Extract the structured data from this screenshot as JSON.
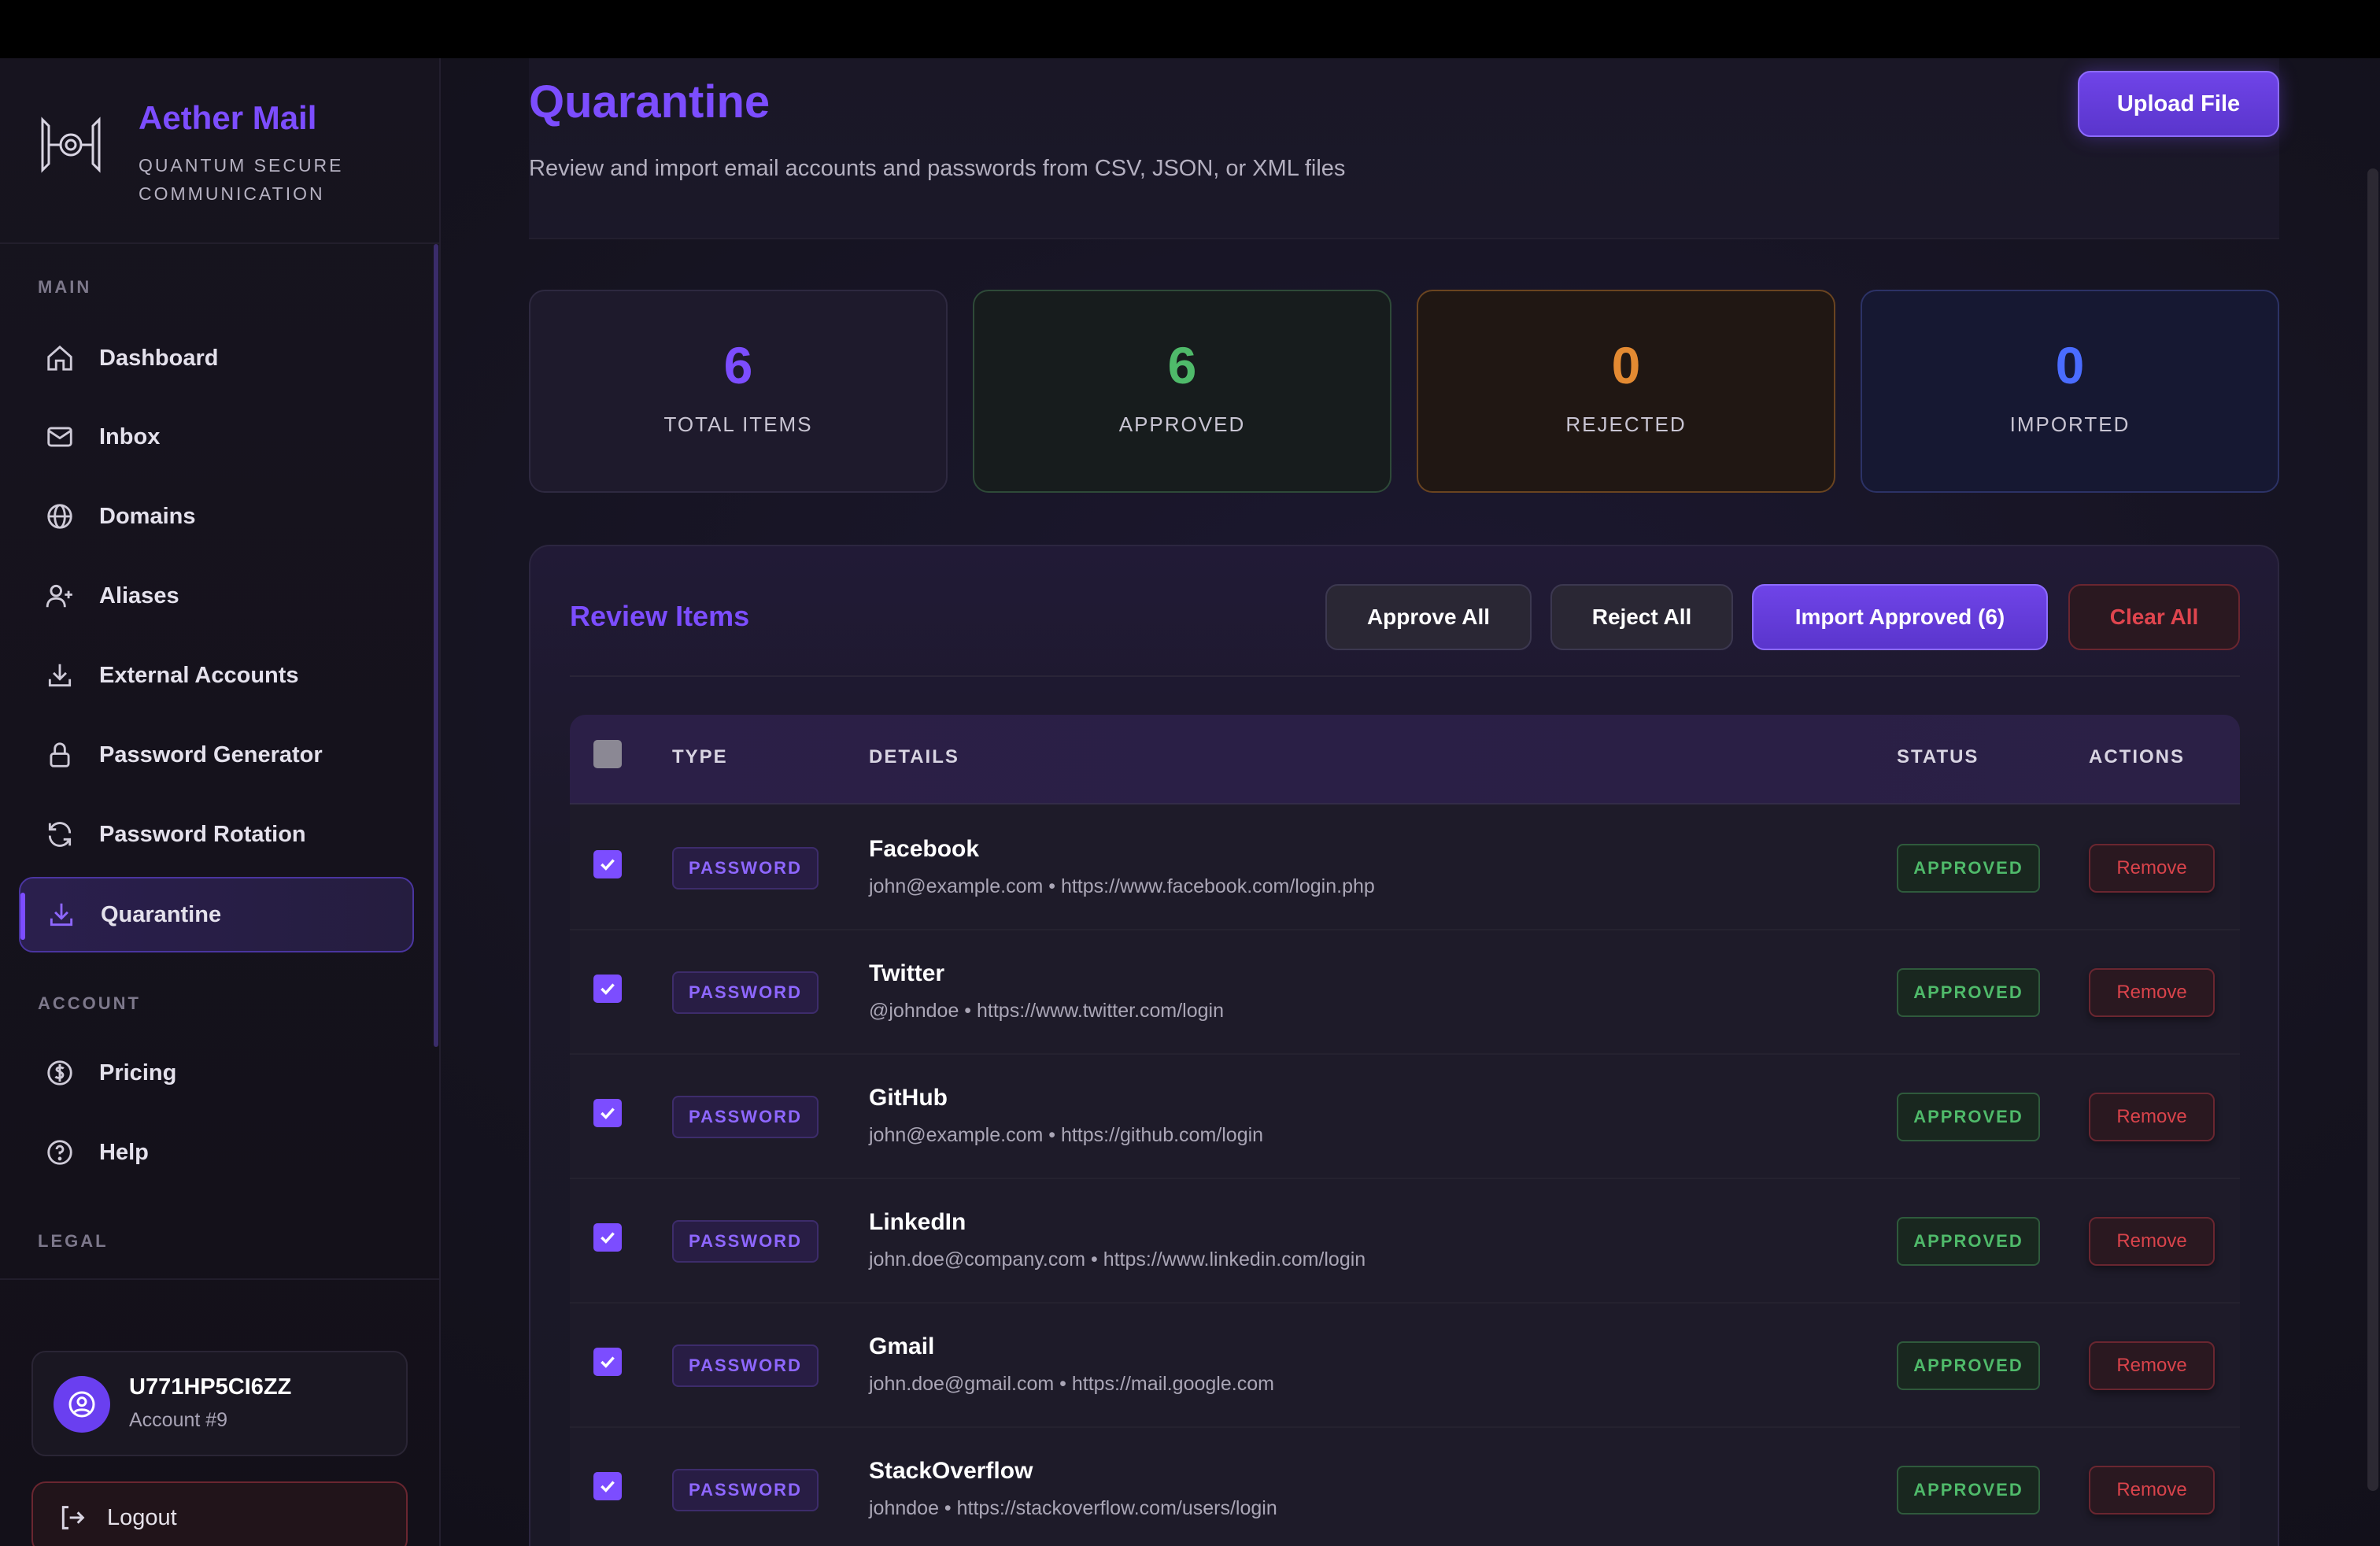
{
  "brand": {
    "name": "Aether Mail",
    "tagline": "QUANTUM SECURE COMMUNICATION"
  },
  "sidebar": {
    "main_label": "MAIN",
    "main_items": [
      {
        "label": "Dashboard",
        "icon": "home-icon"
      },
      {
        "label": "Inbox",
        "icon": "mail-icon"
      },
      {
        "label": "Domains",
        "icon": "globe-icon"
      },
      {
        "label": "Aliases",
        "icon": "user-plus-icon"
      },
      {
        "label": "External Accounts",
        "icon": "download-icon"
      },
      {
        "label": "Password Generator",
        "icon": "lock-icon"
      },
      {
        "label": "Password Rotation",
        "icon": "refresh-icon"
      },
      {
        "label": "Quarantine",
        "icon": "download-icon",
        "active": true
      }
    ],
    "account_label": "ACCOUNT",
    "account_items": [
      {
        "label": "Pricing",
        "icon": "dollar-icon"
      },
      {
        "label": "Help",
        "icon": "help-icon"
      }
    ],
    "legal_label": "LEGAL"
  },
  "account": {
    "id": "U771HP5CI6ZZ",
    "sub": "Account #9"
  },
  "logout_label": "Logout",
  "header": {
    "title": "Quarantine",
    "subtitle": "Review and import email accounts and passwords from CSV, JSON, or XML files",
    "upload_label": "Upload File"
  },
  "stats": {
    "total": {
      "value": "6",
      "label": "TOTAL ITEMS"
    },
    "approved": {
      "value": "6",
      "label": "APPROVED"
    },
    "rejected": {
      "value": "0",
      "label": "REJECTED"
    },
    "imported": {
      "value": "0",
      "label": "IMPORTED"
    }
  },
  "review": {
    "title": "Review Items",
    "approve_all": "Approve All",
    "reject_all": "Reject All",
    "import_approved": "Import Approved (6)",
    "clear_all": "Clear All",
    "columns": {
      "type": "TYPE",
      "details": "DETAILS",
      "status": "STATUS",
      "actions": "ACTIONS"
    },
    "rows": [
      {
        "type": "PASSWORD",
        "title": "Facebook",
        "details": "john@example.com • https://www.facebook.com/login.php",
        "status": "APPROVED",
        "action": "Remove",
        "checked": true
      },
      {
        "type": "PASSWORD",
        "title": "Twitter",
        "details": "@johndoe • https://www.twitter.com/login",
        "status": "APPROVED",
        "action": "Remove",
        "checked": true
      },
      {
        "type": "PASSWORD",
        "title": "GitHub",
        "details": "john@example.com • https://github.com/login",
        "status": "APPROVED",
        "action": "Remove",
        "checked": true
      },
      {
        "type": "PASSWORD",
        "title": "LinkedIn",
        "details": "john.doe@company.com • https://www.linkedin.com/login",
        "status": "APPROVED",
        "action": "Remove",
        "checked": true
      },
      {
        "type": "PASSWORD",
        "title": "Gmail",
        "details": "john.doe@gmail.com • https://mail.google.com",
        "status": "APPROVED",
        "action": "Remove",
        "checked": true
      },
      {
        "type": "PASSWORD",
        "title": "StackOverflow",
        "details": "johndoe • https://stackoverflow.com/users/login",
        "status": "APPROVED",
        "action": "Remove",
        "checked": true
      }
    ]
  },
  "colors": {
    "accent": "#7c4dff",
    "approved": "#4fba6a",
    "rejected": "#e38a32",
    "imported": "#4a6cff",
    "danger": "#d9434b"
  }
}
